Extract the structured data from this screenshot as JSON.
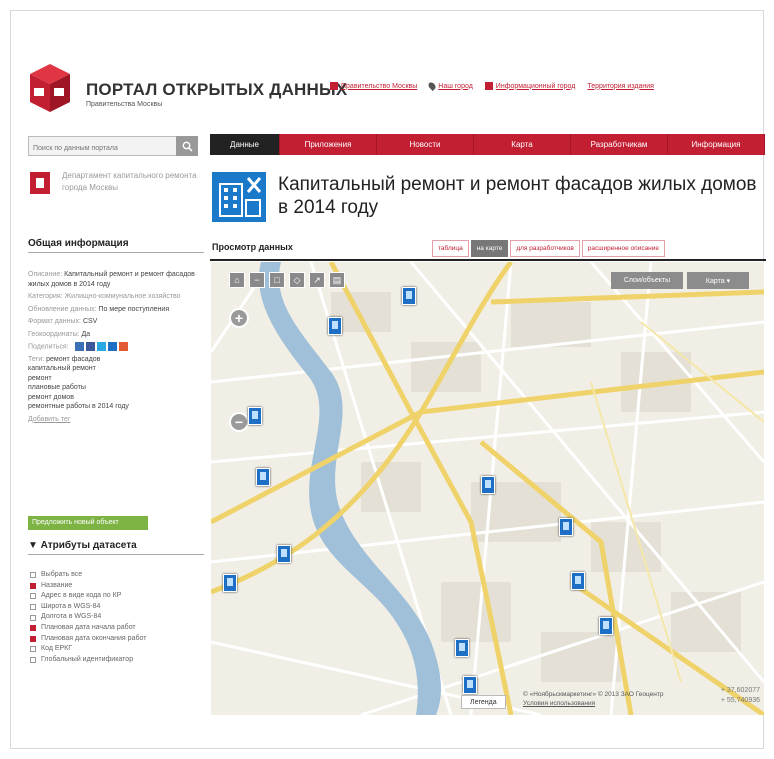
{
  "header": {
    "title": "ПОРТАЛ ОТКРЫТЫХ ДАННЫХ",
    "subtitle": "Правительства Москвы",
    "links": [
      {
        "label": "Правительство Москвы",
        "icon": "building-icon"
      },
      {
        "label": "Наш город",
        "icon": "map-pin-icon"
      },
      {
        "label": "Информационный город",
        "icon": "info-book-icon"
      },
      {
        "label": "Территория издания",
        "icon": ""
      }
    ]
  },
  "search": {
    "placeholder": "Поиск по данным портала",
    "icon": "search-icon"
  },
  "nav": [
    {
      "label": "Данные",
      "active": true
    },
    {
      "label": "Приложения",
      "active": false
    },
    {
      "label": "Новости",
      "active": false
    },
    {
      "label": "Карта",
      "active": false
    },
    {
      "label": "Разработчикам",
      "active": false
    },
    {
      "label": "Информация",
      "active": false
    }
  ],
  "sidebar": {
    "department": "Департамент капитального ремонта города Москвы",
    "general_heading": "Общая информация",
    "info": [
      {
        "key": "Описание:",
        "value": "Капитальный ремонт и ремонт фасадов жилых домов в 2014 году"
      },
      {
        "key": "Категория:",
        "value": "Жилищно-коммунальное хозяйство"
      },
      {
        "key": "Обновление данных:",
        "value": "По мере поступления"
      },
      {
        "key": "Формат данных:",
        "value": "CSV"
      },
      {
        "key": "Геокоординаты:",
        "value": "Да"
      },
      {
        "key": "Поделиться:",
        "value": ""
      }
    ],
    "tags_label": "Теги:",
    "tags": [
      "ремонт фасадов",
      "капитальный ремонт",
      "ремонт",
      "плановые работы",
      "ремонт домов",
      "ремонтные работы в 2014 году"
    ],
    "add_tag": "Добавить тег",
    "propose_button": "Предложить новый объект",
    "attributes_heading": "▼ Атрибуты датасета",
    "attributes": [
      {
        "label": "Выбрать все",
        "checked": false
      },
      {
        "label": "Название",
        "checked": true
      },
      {
        "label": "Адрес в виде кода по КР",
        "checked": false
      },
      {
        "label": "Широта в WGS-84",
        "checked": false
      },
      {
        "label": "Долгота в WGS-84",
        "checked": false
      },
      {
        "label": "Плановая дата начала работ",
        "checked": true
      },
      {
        "label": "Плановая дата окончания работ",
        "checked": true
      },
      {
        "label": "Код ЕРКГ",
        "checked": false
      },
      {
        "label": "Глобальный идентификатор",
        "checked": false
      }
    ]
  },
  "dataset": {
    "title": "Капитальный ремонт и ремонт фасадов жилых домов в 2014 году",
    "view_heading": "Просмотр данных",
    "view_tabs": [
      {
        "label": "таблица",
        "active": false
      },
      {
        "label": "на карте",
        "active": true
      },
      {
        "label": "для разработчиков",
        "active": false
      },
      {
        "label": "расширенное описание",
        "active": false
      }
    ]
  },
  "map": {
    "objects_button": "Слои/объекты",
    "type_button": "Карта ▾",
    "legend": "Легенда",
    "copyright": "© «Ноябрьскмаркетинг» © 2013 ЗАО Геоцентр",
    "terms": "Условия использования",
    "coord_lat": "+ 37,602077",
    "coord_lon": "+ 55,740936",
    "colors": {
      "road": "#efd36a",
      "river": "#9fc0d8",
      "marker": "#1d6fc6"
    }
  },
  "colors": {
    "brand": "#c21f33",
    "nav_active": "#222222",
    "button_green": "#7cb342"
  }
}
